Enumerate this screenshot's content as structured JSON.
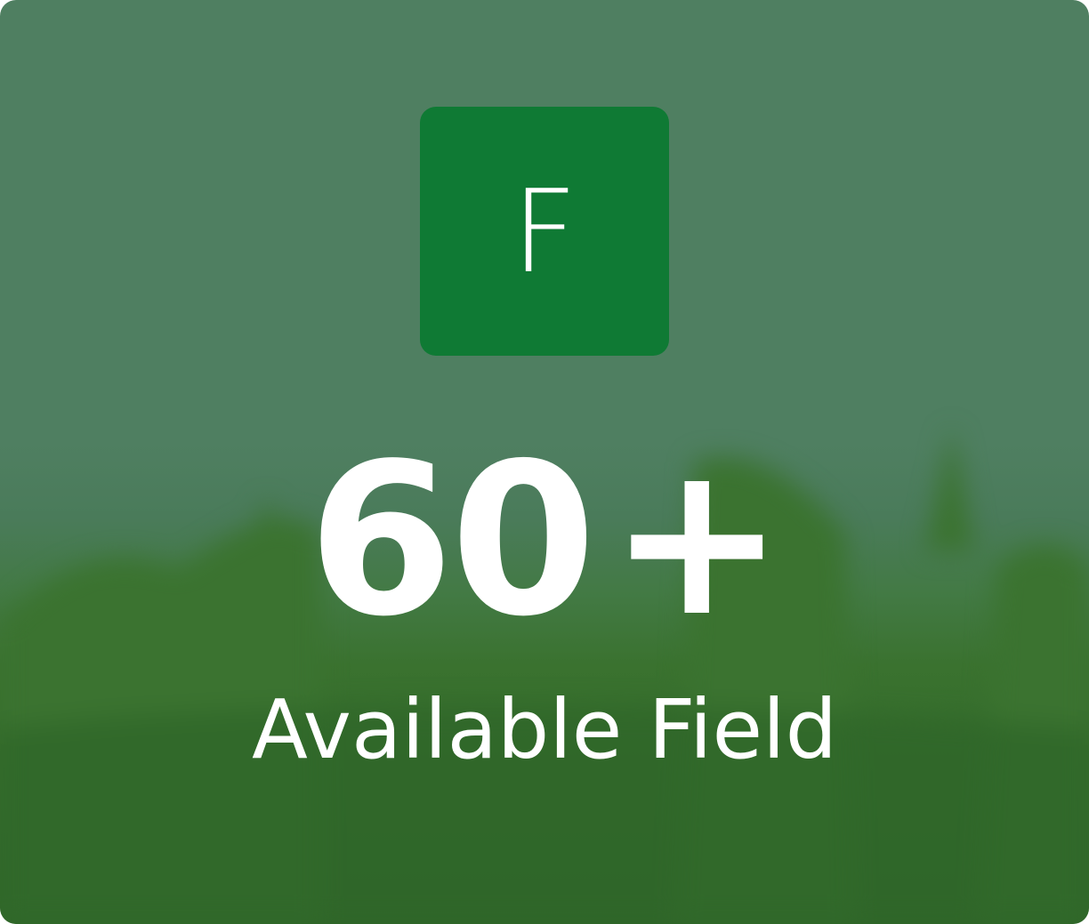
{
  "card": {
    "logo_letter": "F",
    "stat_value": "60",
    "stat_suffix": "+",
    "caption": "Available Field"
  },
  "colors": {
    "logo_bg": "#0f7a34",
    "text": "#ffffff",
    "overlay_top": "#4f7f61",
    "grass": "#336b2b"
  },
  "icons": {
    "background": "grass-field-image"
  }
}
